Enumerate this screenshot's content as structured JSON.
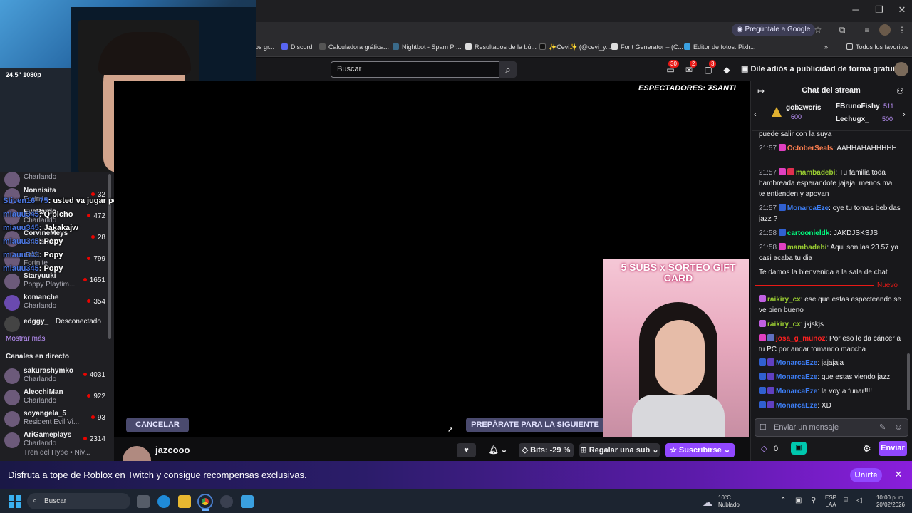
{
  "chrome": {
    "ask_google": "Pregúntale a Google",
    "bookmarks": [
      "os gr...",
      "Discord",
      "Calculadora gráfica...",
      "Nightbot - Spam Pr...",
      "Resultados de la bú...",
      "✨Cevi✨ (@cevi_y...",
      "Font Generator – (C...",
      "Editor de fotos: Pixlr..."
    ],
    "all_favorites": "Todos los favoritos"
  },
  "twitch_nav": {
    "search_placeholder": "Buscar",
    "badge1": "30",
    "badge2": "2",
    "badge3": "3",
    "adfree": "Dile adiós a publicidad de forma gratuita"
  },
  "webcam_overlay": {
    "monitor_text": "24.5\" 1080p"
  },
  "sidebar": {
    "followed": [
      {
        "name": "",
        "sub": "Charlando",
        "viewers": ""
      },
      {
        "name": "Nonnisita",
        "sub": "Fortnite",
        "viewers": "32"
      },
      {
        "name": "EvePardo",
        "sub": "Charlando",
        "viewers": "472"
      },
      {
        "name": "CorvineMeys",
        "sub": "Charlando",
        "viewers": "28"
      },
      {
        "name": "Jakk",
        "sub": "Fortnite",
        "viewers": "799"
      },
      {
        "name": "Staryuuki",
        "sub": "Poppy Playtim...",
        "viewers": "1651"
      },
      {
        "name": "komanche",
        "sub": "Charlando",
        "viewers": "354"
      }
    ],
    "offline": {
      "name": "edggy_",
      "status": "Desconectado"
    },
    "show_more": "Mostrar más",
    "live_header": "Canales en directo",
    "live": [
      {
        "name": "sakurashymko",
        "sub": "Charlando",
        "viewers": "4031"
      },
      {
        "name": "AlecchiMan",
        "sub": "Charlando",
        "viewers": "922"
      },
      {
        "name": "soyangela_5",
        "sub": "Resident Evil Vi...",
        "viewers": "93"
      },
      {
        "name": "AriGameplays",
        "sub": "Charlando",
        "viewers": "2314"
      }
    ],
    "hype": "Tren del Hype • Niv..."
  },
  "overlay_chat": [
    {
      "user": "Stiven16_75",
      "text": ": usted va jugar poppy ?"
    },
    {
      "user": "miauu345",
      "text": ": Q picho"
    },
    {
      "user": "miauu345",
      "text": ": Jakakajw"
    },
    {
      "user": "miauu345",
      "text": ": Popy"
    },
    {
      "user": "miauu345",
      "text": ": Popy"
    },
    {
      "user": "miauu345",
      "text": ": Popy"
    }
  ],
  "player": {
    "viewers_label": "ESPECTADORES: ₮SANTI",
    "cancel": "CANCELAR",
    "prepare": "PREPÁRATE PARA LA SIGUIENTE",
    "cam2_banner": "5 SUBS x SORTEO GIFT CARD"
  },
  "channel": {
    "name": "jazcooo",
    "bits": "Bits: -29 %",
    "gift": "Regalar una sub",
    "subscribe": "Suscribirse"
  },
  "chat": {
    "title": "Chat del stream",
    "pinned": [
      {
        "name": "gob2wcris",
        "amount": "600"
      },
      {
        "name": "FBrunoFishy",
        "amount": "511"
      },
      {
        "name": "Lechugx_",
        "amount": "500"
      }
    ],
    "messages": [
      {
        "time": "",
        "user": "",
        "user_color": "#efeff1",
        "text": "puede salir con la suya"
      },
      {
        "time": "21:57",
        "user": "OctoberSeals",
        "user_color": "#ff7f50",
        "text": "AAHHAHAHHHHH"
      },
      {
        "time": "21:57",
        "user": "mambadebi",
        "user_color": "#9acd32",
        "text": "Tu familia toda hambreada esperandote jajaja, menos mal te entienden y apoyan"
      },
      {
        "time": "21:57",
        "user": "MonarcaEze",
        "user_color": "#3d7ef5",
        "text": "oye tu tomas bebidas jazz ?"
      },
      {
        "time": "21:58",
        "user": "cartoonieldk",
        "user_color": "#00ff7f",
        "text": "JAKDJSKSJS"
      },
      {
        "time": "21:58",
        "user": "mambadebi",
        "user_color": "#9acd32",
        "text": "Aqui son las 23.57 ya casi acaba tu dia"
      }
    ],
    "welcome": "Te damos la bienvenida a la sala de chat",
    "new_label": "Nuevo",
    "new_messages": [
      {
        "user": "raikiry_cx",
        "user_color": "#9acd32",
        "text": "ese que estas especteando se ve bien bueno"
      },
      {
        "user": "raikiry_cx",
        "user_color": "#9acd32",
        "text": "jkjskjs"
      },
      {
        "user": "josa_g_munoz",
        "user_color": "#ff2020",
        "text": "Por eso le da cáncer a tu PC por andar tomando maccha"
      },
      {
        "user": "MonarcaEze",
        "user_color": "#3d7ef5",
        "text": "jajajaja"
      },
      {
        "user": "MonarcaEze",
        "user_color": "#3d7ef5",
        "text": "que estas viendo jazz"
      },
      {
        "user": "MonarcaEze",
        "user_color": "#3d7ef5",
        "text": "la voy a funar!!!!"
      },
      {
        "user": "MonarcaEze",
        "user_color": "#3d7ef5",
        "text": "XD"
      }
    ],
    "input_placeholder": "Enviar un mensaje",
    "points": "0",
    "send": "Enviar"
  },
  "promo": {
    "text": "Disfruta a tope de Roblox en Twitch y consigue recompensas exclusivas.",
    "join": "Unirte"
  },
  "taskbar": {
    "search": "Buscar",
    "weather_temp": "10°C",
    "weather_desc": "Nublado",
    "lang1": "ESP",
    "lang2": "LAA",
    "time": "10:00 p. m.",
    "date": "20/02/2026"
  }
}
